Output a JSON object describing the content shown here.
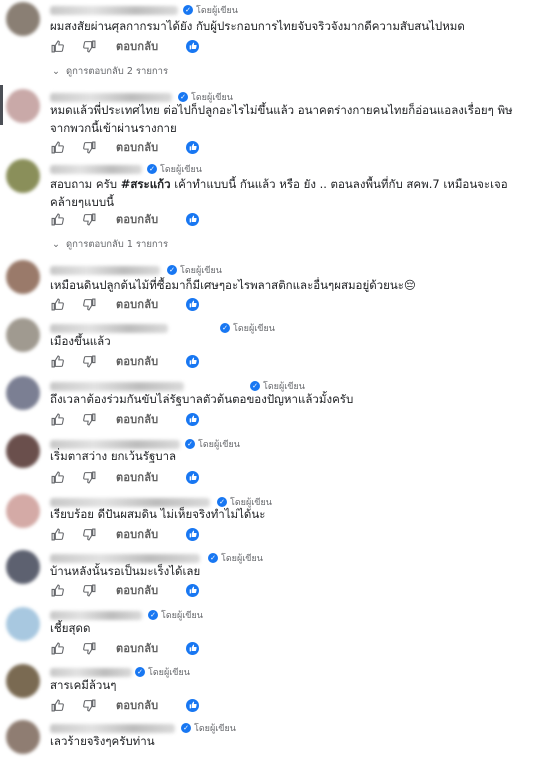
{
  "author_badge_text": "โดยผู้เขียน",
  "reply_label": "ตอบกลับ",
  "comments": [
    {
      "text": "ผมสงสัยผ่านศุลกากรมาได้ยัง กับผู้ประกอบการไทยจับจริวจังมากดีความสับสนไปหมด",
      "view_replies": "ดูการตอบกลับ 2 รายการ"
    },
    {
      "text": "หมดแล้วพี่ประเทศไทย ต่อไปก็ปลูกอะไรไม่ขึ้นแล้ว อนาคตร่างกายคนไทยก็อ่อนแอลงเรื่อยๆ พิษจากพวกนี้เข้าผ่านรางกาย"
    },
    {
      "text_plain": "สอบถาม ครับ ",
      "text_hashtag": "#สระแก้ว",
      "text_rest": " เค้าทำแบบนี้ กันแล้ว หรือ ยัง .. ตอนลงพื้นที่กับ สคพ.7 เหมือนจะเจอคล้ายๆแบบนี้",
      "view_replies": "ดูการตอบกลับ 1 รายการ"
    },
    {
      "text": "เหมือนดินปลูกต้นไม้ที่ซื้อมาก็มีเศษๆอะไรพลาสติกและอื่นๆผสมอยู่ด้วยนะ😔"
    },
    {
      "text": "เมืองขึ้นแล้ว"
    },
    {
      "text": "ถึงเวลาต้องร่วมกันขับไล่รัฐบาลตัวต้นตอของปัญหาแล้วมั้งครับ"
    },
    {
      "text": "เริ่มตาสว่าง ยกเว้นรัฐบาล"
    },
    {
      "text": "เรียบร้อย ดีปันผสมดิน ไม่เห็ยจริงทำไม่ได้นะ"
    },
    {
      "text": "บ้านหลังนั้นรอเป็นมะเร็งได้เลย"
    },
    {
      "text": "เชี้ยสุดด"
    },
    {
      "text": "สารเคมีล้วนๆ"
    },
    {
      "text": "เลวร้ายจริงๆครับท่าน"
    }
  ]
}
